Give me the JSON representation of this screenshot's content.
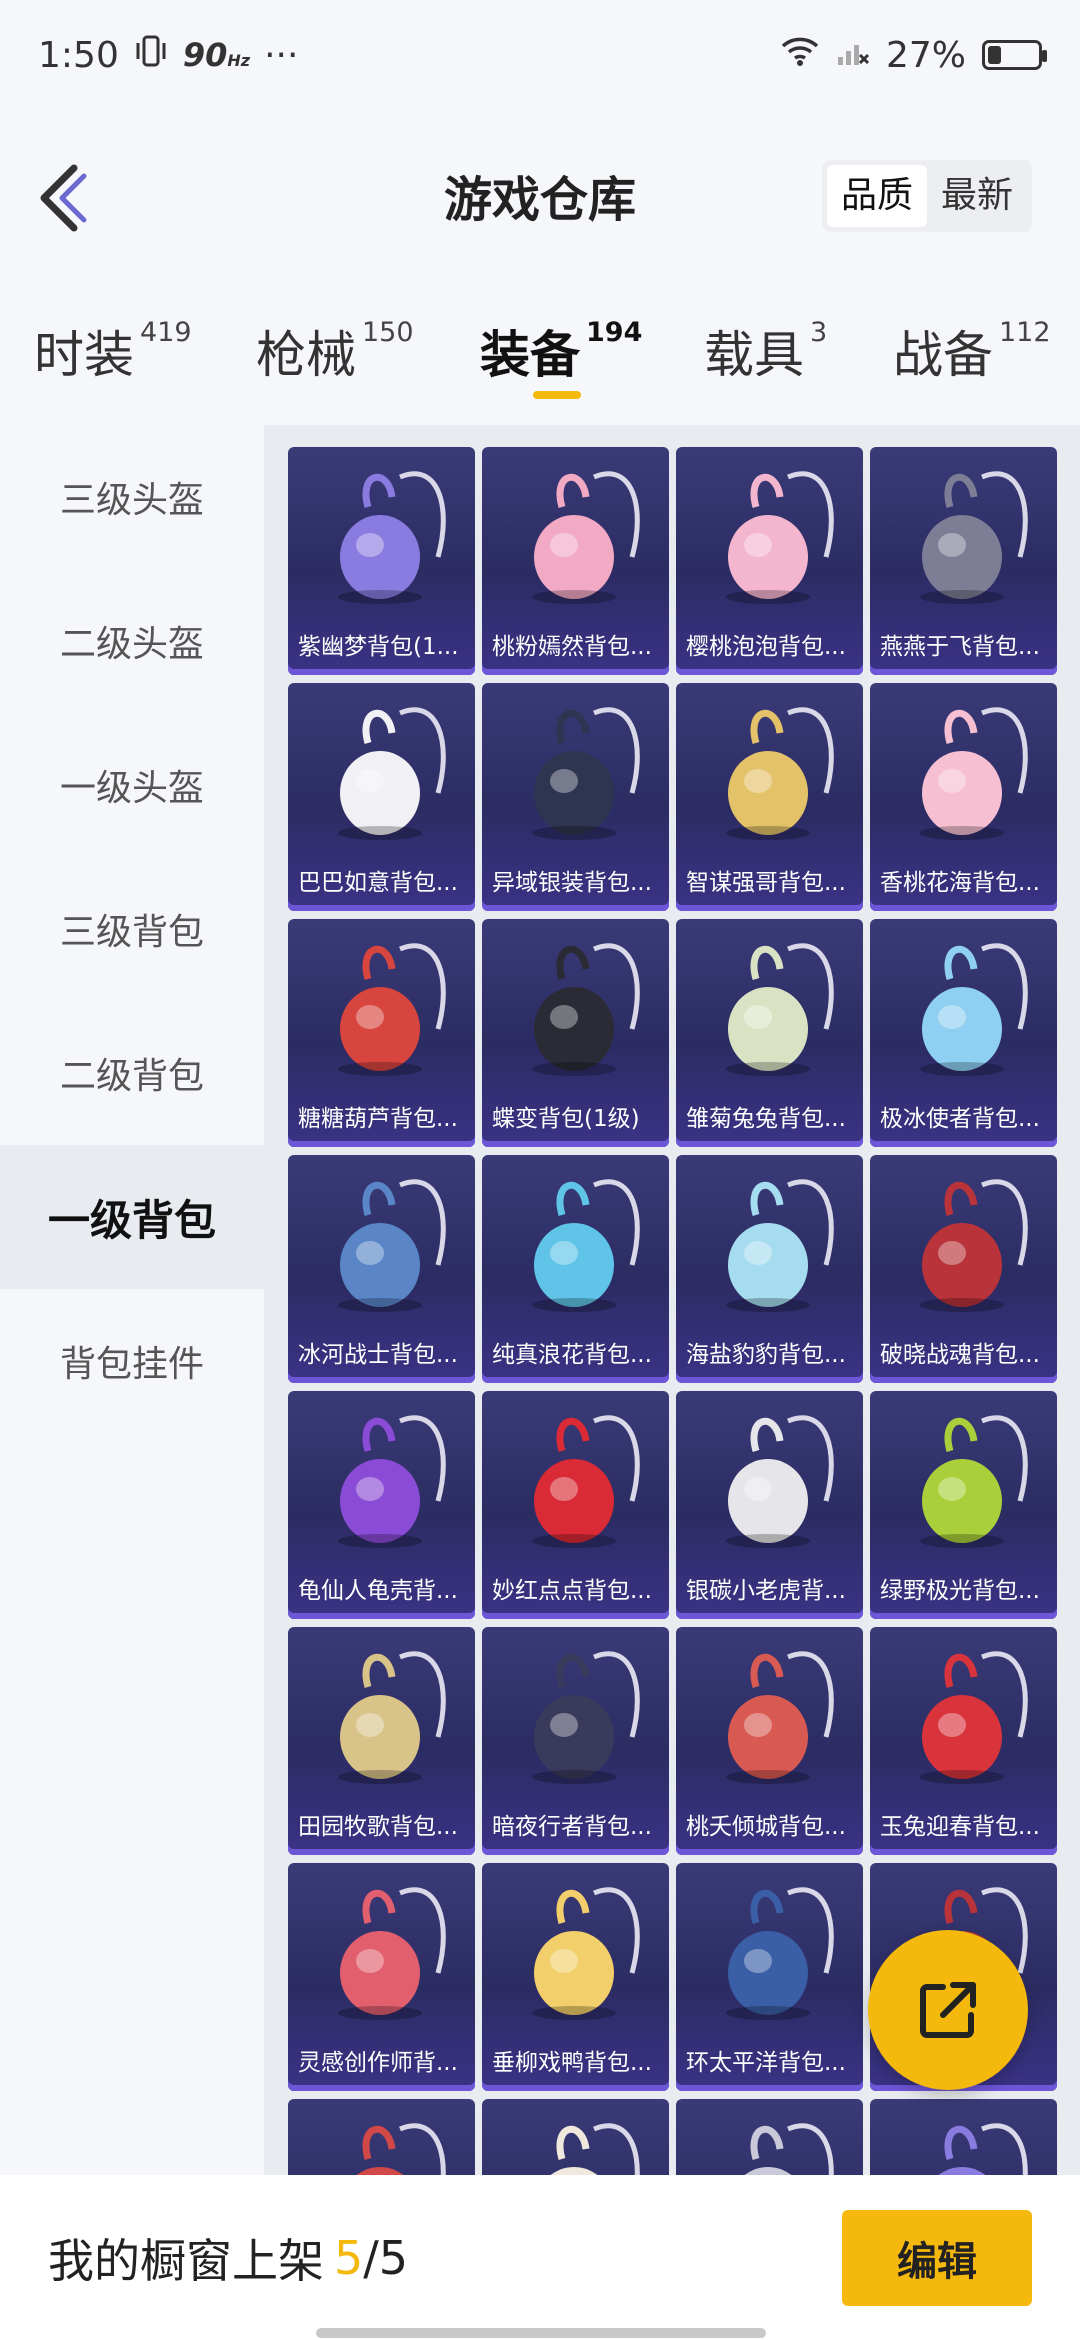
{
  "status_bar": {
    "time": "1:50",
    "refresh_rate": "90",
    "refresh_unit": "Hz",
    "more": "···",
    "battery_text": "27%",
    "battery_level": 0.27
  },
  "header": {
    "title": "游戏仓库",
    "sort_options": [
      "品质",
      "最新"
    ],
    "active_sort": "品质"
  },
  "tabs": [
    {
      "label": "时装",
      "count": "419"
    },
    {
      "label": "枪械",
      "count": "150"
    },
    {
      "label": "装备",
      "count": "194",
      "active": true
    },
    {
      "label": "载具",
      "count": "3"
    },
    {
      "label": "战备",
      "count": "112"
    }
  ],
  "sidebar": {
    "items": [
      "三级头盔",
      "二级头盔",
      "一级头盔",
      "三级背包",
      "二级背包",
      "一级背包",
      "背包挂件"
    ],
    "active": "一级背包"
  },
  "items": [
    {
      "name": "紫幽梦背包(1...",
      "color": "#8a7be0"
    },
    {
      "name": "桃粉嫣然背包...",
      "color": "#f2a9c4"
    },
    {
      "name": "樱桃泡泡背包...",
      "color": "#f4b6cf"
    },
    {
      "name": "燕燕于飞背包...",
      "color": "#7d7d96"
    },
    {
      "name": "巴巴如意背包...",
      "color": "#f1f1f5"
    },
    {
      "name": "异域银装背包...",
      "color": "#2e3550"
    },
    {
      "name": "智谋强哥背包...",
      "color": "#e4c26a"
    },
    {
      "name": "香桃花海背包...",
      "color": "#f6bfd2"
    },
    {
      "name": "糖糖葫芦背包...",
      "color": "#d8453f"
    },
    {
      "name": "蝶变背包(1级)",
      "color": "#2b2b36"
    },
    {
      "name": "雏菊兔兔背包...",
      "color": "#d9e3c4"
    },
    {
      "name": "极冰使者背包...",
      "color": "#8fd0f2"
    },
    {
      "name": "冰河战士背包...",
      "color": "#5a86c8"
    },
    {
      "name": "纯真浪花背包...",
      "color": "#5fc4e8"
    },
    {
      "name": "海盐豹豹背包...",
      "color": "#a6dcef"
    },
    {
      "name": "破晓战魂背包...",
      "color": "#b8333a"
    },
    {
      "name": "龟仙人龟壳背...",
      "color": "#8a4bd6"
    },
    {
      "name": "妙红点点背包...",
      "color": "#d92a35"
    },
    {
      "name": "银碳小老虎背...",
      "color": "#e6e6ea"
    },
    {
      "name": "绿野极光背包...",
      "color": "#a9cf3a"
    },
    {
      "name": "田园牧歌背包...",
      "color": "#d8c389"
    },
    {
      "name": "暗夜行者背包...",
      "color": "#3a3a5c"
    },
    {
      "name": "桃夭倾城背包...",
      "color": "#d85a52"
    },
    {
      "name": "玉兔迎春背包...",
      "color": "#d9343c"
    },
    {
      "name": "灵感创作师背...",
      "color": "#e25f6e"
    },
    {
      "name": "垂柳戏鸭背包...",
      "color": "#f2cf6a"
    },
    {
      "name": "环太平洋背包...",
      "color": "#3a5fa6"
    },
    {
      "name": "",
      "color": "#b8333a"
    },
    {
      "name": "",
      "color": "#d04848"
    },
    {
      "name": "",
      "color": "#f0e8dc"
    },
    {
      "name": "",
      "color": "#c9c9d9"
    },
    {
      "name": "",
      "color": "#8a7be0"
    }
  ],
  "bottom_bar": {
    "showcase_label": "我的橱窗上架",
    "showcase_current": "5",
    "showcase_total": "/5",
    "edit_label": "编辑"
  },
  "colors": {
    "accent": "#f5b80c",
    "card_bg": "#2c2c63"
  }
}
